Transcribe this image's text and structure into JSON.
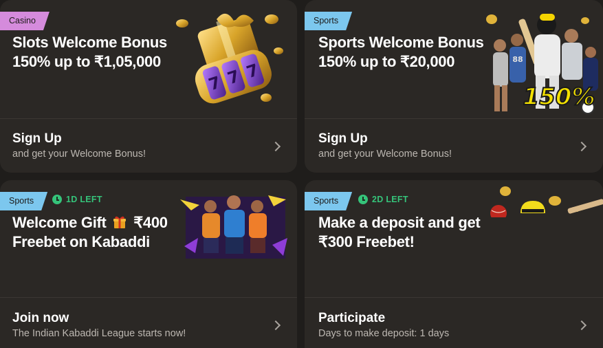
{
  "cards": [
    {
      "tag": "Casino",
      "title_line1": "Slots Welcome Bonus",
      "title_line2": "150% up to ₹1,05,000",
      "footer_title": "Sign Up",
      "footer_sub": "and get your Welcome Bonus!",
      "art_icon": "gift-slot-777-icon"
    },
    {
      "tag": "Sports",
      "title_line1": "Sports Welcome Bonus",
      "title_line2": "150% up to ₹20,000",
      "footer_title": "Sign Up",
      "footer_sub": "and get your Welcome Bonus!",
      "art_badge": "150%",
      "art_icon": "sports-players-icon"
    },
    {
      "tag": "Sports",
      "timer": "1D LEFT",
      "title_line1a": "Welcome Gift",
      "title_line1b": "₹400",
      "title_line2": "Freebet on Kabaddi",
      "footer_title": "Join now",
      "footer_sub": "The Indian Kabaddi League starts now!",
      "art_icon": "kabaddi-players-icon"
    },
    {
      "tag": "Sports",
      "timer": "2D LEFT",
      "title_line1": "Make a deposit and get",
      "title_line2": "₹300 Freebet!",
      "footer_title": "Participate",
      "footer_sub": "Days to make deposit: 1 days",
      "art_icon": "cricket-ball-helmet-icon"
    }
  ],
  "colors": {
    "casino_tag": "#d58bdc",
    "sports_tag": "#7cc7ee",
    "timer": "#35c47a",
    "card_bg": "#2b2825",
    "page_bg": "#1f1d1b"
  }
}
